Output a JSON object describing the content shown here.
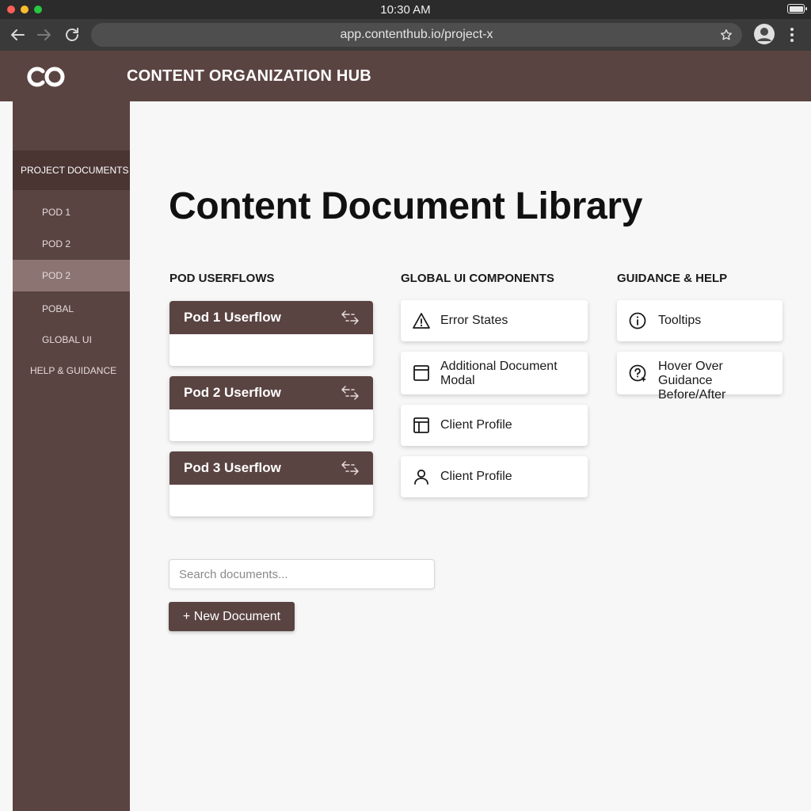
{
  "status_bar": {
    "time": "10:30 AM"
  },
  "browser": {
    "url": "app.contenthub.io/project-x"
  },
  "app": {
    "title": "CONTENT ORGANIZATION HUB",
    "logo_text": "CO"
  },
  "sidebar": {
    "section_title": "PROJECT DOCUMENTS",
    "items": [
      {
        "label": "POD 1",
        "active": false
      },
      {
        "label": "POD 2",
        "active": false
      },
      {
        "label": "POD 2",
        "active": true
      },
      {
        "label": "POBAL",
        "active": false
      },
      {
        "label": "GLOBAL UI",
        "active": false
      },
      {
        "label": "HELP & GUIDANCE",
        "active": false
      }
    ]
  },
  "main": {
    "title": "Content Document Library",
    "columns": [
      {
        "heading": "POD USERFLOWS",
        "cards": [
          {
            "title": "Pod 1 Userflow",
            "icon": "swap-arrows-icon"
          },
          {
            "title": "Pod 2 Userflow",
            "icon": "swap-arrows-icon"
          },
          {
            "title": "Pod 3 Userflow",
            "icon": "swap-arrows-icon"
          }
        ]
      },
      {
        "heading": "GLOBAL UI COMPONENTS",
        "cards": [
          {
            "title": "Error States",
            "icon": "warning-icon"
          },
          {
            "title": "Additional Document Modal",
            "icon": "window-icon"
          },
          {
            "title": "Client Profile",
            "icon": "layout-icon"
          },
          {
            "title": "Client Profile",
            "icon": "user-icon"
          }
        ]
      },
      {
        "heading": "GUIDANCE & HELP",
        "cards": [
          {
            "title": "Tooltips",
            "icon": "info-icon"
          },
          {
            "title": "Hover Over Guidance Before/After",
            "icon": "help-cursor-icon"
          }
        ]
      }
    ],
    "search": {
      "placeholder": "Search documents..."
    },
    "new_document_label": "+ New Document"
  },
  "colors": {
    "brand": "#5a4442",
    "brand_dark": "#4a3533",
    "active_item": "#8b7472"
  }
}
